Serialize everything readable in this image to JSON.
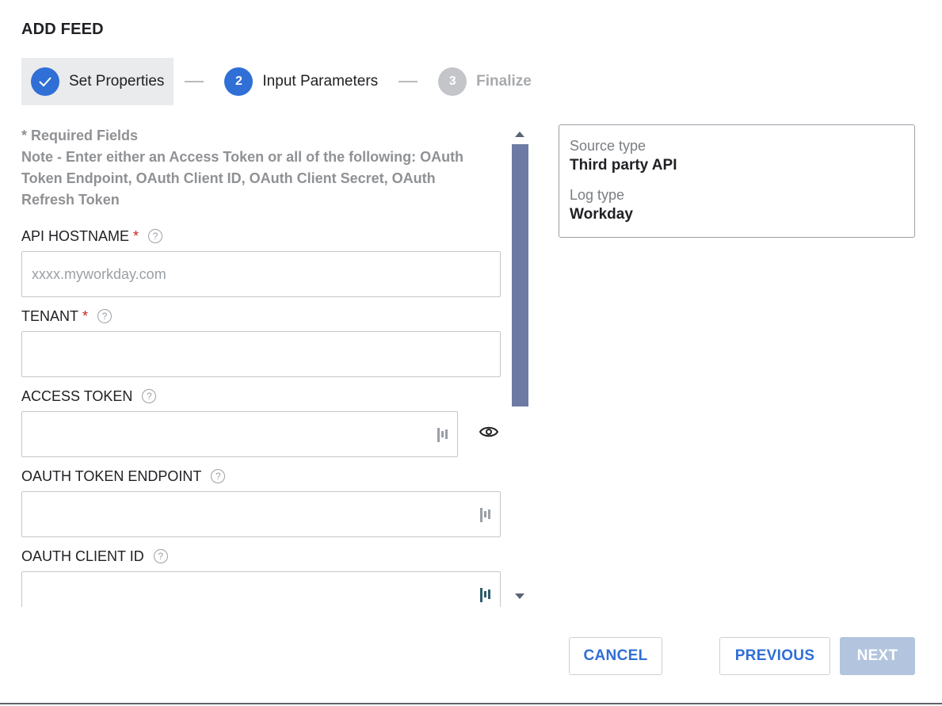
{
  "dialog": {
    "title": "ADD FEED"
  },
  "stepper": {
    "steps": [
      {
        "number": "",
        "label": "Set Properties",
        "state": "done"
      },
      {
        "number": "2",
        "label": "Input Parameters",
        "state": "active"
      },
      {
        "number": "3",
        "label": "Finalize",
        "state": "upcoming"
      }
    ]
  },
  "form": {
    "required_text": "* Required Fields",
    "note_text": "Note - Enter either an Access Token or all of the following: OAuth Token Endpoint, OAuth Client ID, OAuth Client Secret, OAuth Refresh Token",
    "fields": [
      {
        "label": "API HOSTNAME",
        "required": "*",
        "value": "",
        "placeholder": "xxxx.myworkday.com"
      },
      {
        "label": "TENANT",
        "required": "*",
        "value": "",
        "placeholder": ""
      },
      {
        "label": "ACCESS TOKEN",
        "required": "",
        "value": "",
        "placeholder": ""
      },
      {
        "label": "OAUTH TOKEN ENDPOINT",
        "required": "",
        "value": "",
        "placeholder": ""
      },
      {
        "label": "OAUTH CLIENT ID",
        "required": "",
        "value": "",
        "placeholder": ""
      }
    ],
    "help_glyph": "?"
  },
  "summary": {
    "source_type_label": "Source type",
    "source_type_value": "Third party API",
    "log_type_label": "Log type",
    "log_type_value": "Workday"
  },
  "buttons": {
    "cancel": "CANCEL",
    "previous": "PREVIOUS",
    "next": "NEXT"
  },
  "colors": {
    "accent": "#2f6fd6",
    "required_star": "#c5221f",
    "scroll_thumb": "#6d7aa3",
    "next_disabled": "#b3c4de"
  }
}
